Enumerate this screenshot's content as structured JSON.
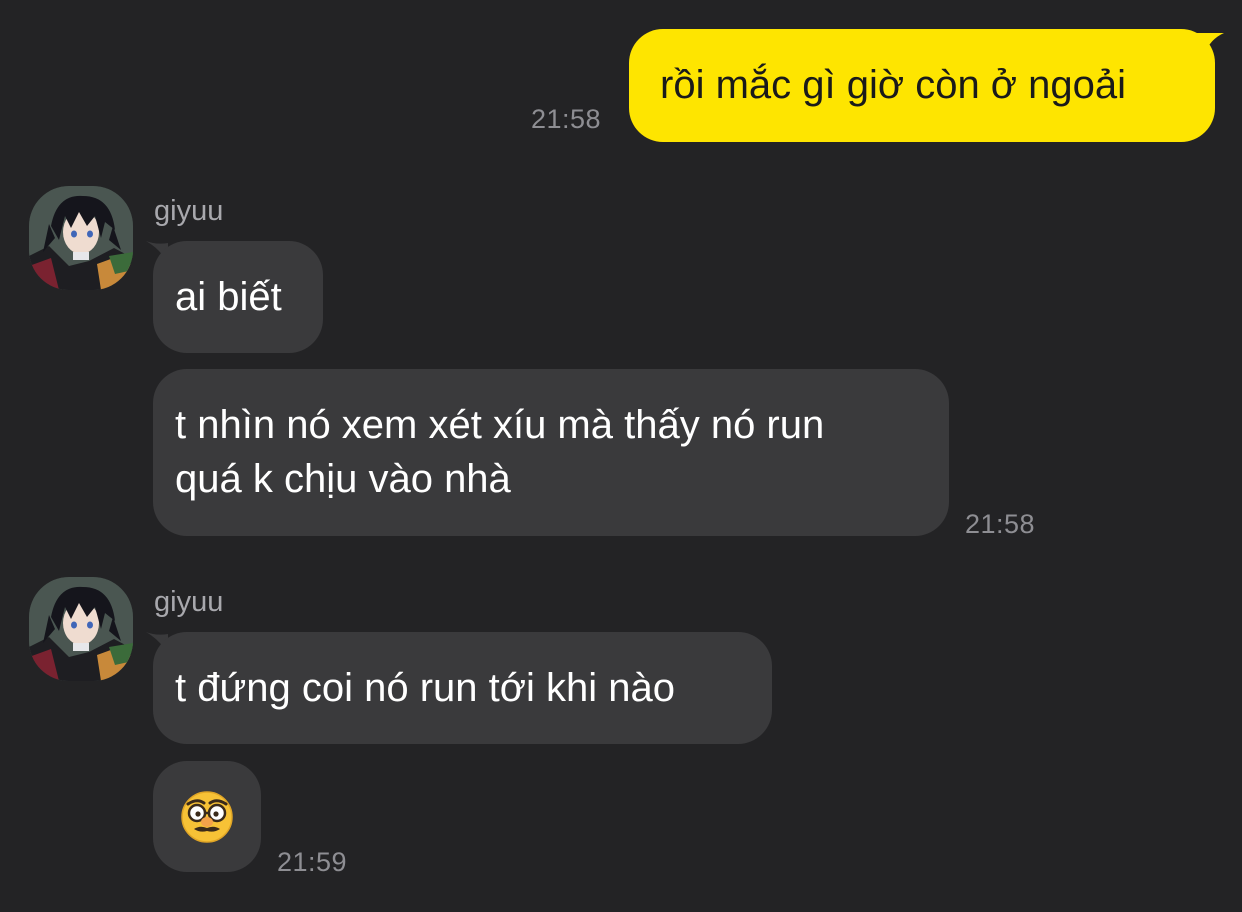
{
  "messages": {
    "outgoing": {
      "text": "rồi mắc gì giờ còn ở ngoải",
      "time": "21:58"
    },
    "group1": {
      "sender": "giyuu",
      "msg1": "ai biết",
      "msg2_line1": "t nhìn nó xem xét xíu mà thấy nó run",
      "msg2_line2": "quá k chịu vào nhà",
      "time": "21:58"
    },
    "group2": {
      "sender": "giyuu",
      "msg1": "t đứng coi nó run tới khi nào",
      "emoji": "disguised-face-emoji",
      "time": "21:59"
    }
  },
  "colors": {
    "background": "#232325",
    "outgoing_bubble": "#fee500",
    "incoming_bubble": "#3a3a3c",
    "timestamp": "#8e8e93"
  }
}
